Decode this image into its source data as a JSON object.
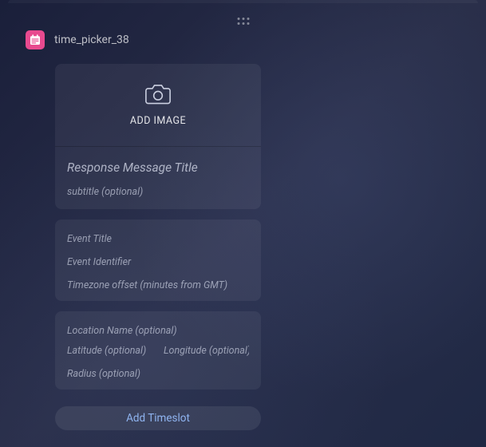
{
  "header": {
    "title": "time_picker_38"
  },
  "responseCard": {
    "addImageLabel": "ADD IMAGE",
    "titlePlaceholder": "Response Message Title",
    "subtitlePlaceholder": "subtitle (optional)"
  },
  "eventCard": {
    "titlePlaceholder": "Event Title",
    "identifierPlaceholder": "Event Identifier",
    "timezonePlaceholder": "Timezone offset (minutes from GMT)"
  },
  "locationCard": {
    "namePlaceholder": "Location Name (optional)",
    "latPlaceholder": "Latitude (optional)",
    "lngPlaceholder": "Longitude (optional)",
    "radiusPlaceholder": "Radius (optional)"
  },
  "actions": {
    "addTimeslotLabel": "Add Timeslot"
  }
}
